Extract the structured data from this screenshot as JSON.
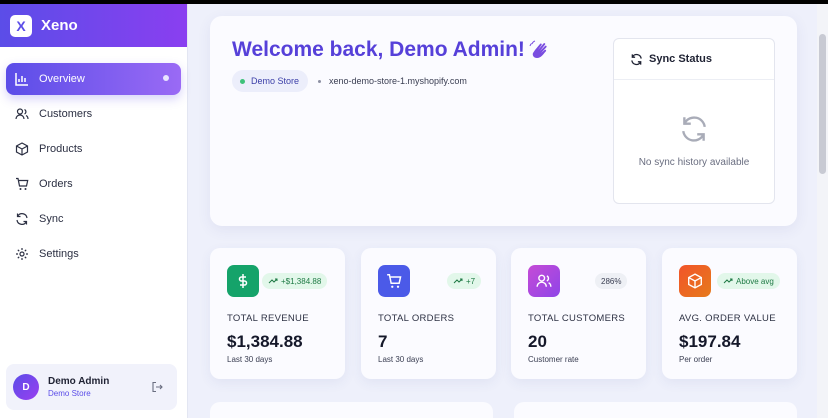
{
  "brand": {
    "logo_letter": "X",
    "name": "Xeno"
  },
  "nav": [
    {
      "label": "Overview",
      "icon": "chart-icon",
      "active": true
    },
    {
      "label": "Customers",
      "icon": "users-icon"
    },
    {
      "label": "Products",
      "icon": "box-icon"
    },
    {
      "label": "Orders",
      "icon": "cart-icon"
    },
    {
      "label": "Sync",
      "icon": "refresh-icon"
    },
    {
      "label": "Settings",
      "icon": "gear-icon"
    }
  ],
  "user": {
    "initial": "D",
    "name": "Demo Admin",
    "store": "Demo Store"
  },
  "welcome": {
    "title": "Welcome back, Demo Admin!",
    "store_badge": "Demo Store",
    "store_url": "xeno-demo-store-1.myshopify.com"
  },
  "sync": {
    "title": "Sync Status",
    "empty": "No sync history available"
  },
  "stats": [
    {
      "label": "TOTAL REVENUE",
      "value": "$1,384.88",
      "sub": "Last 30 days",
      "badge": "+$1,384.88",
      "badge_type": "green",
      "color": "#15a36a"
    },
    {
      "label": "TOTAL ORDERS",
      "value": "7",
      "sub": "Last 30 days",
      "badge": "+7",
      "badge_type": "green",
      "color": "#4b5ae8"
    },
    {
      "label": "TOTAL CUSTOMERS",
      "value": "20",
      "sub": "Customer rate",
      "badge": "286%",
      "badge_type": "grey",
      "color": "#b04ad9"
    },
    {
      "label": "AVG. ORDER VALUE",
      "value": "$197.84",
      "sub": "Per order",
      "badge": "Above avg",
      "badge_type": "green",
      "color": "#ef5a22"
    }
  ],
  "colors": {
    "accent": "#5b4de8",
    "title": "#5640d9"
  }
}
